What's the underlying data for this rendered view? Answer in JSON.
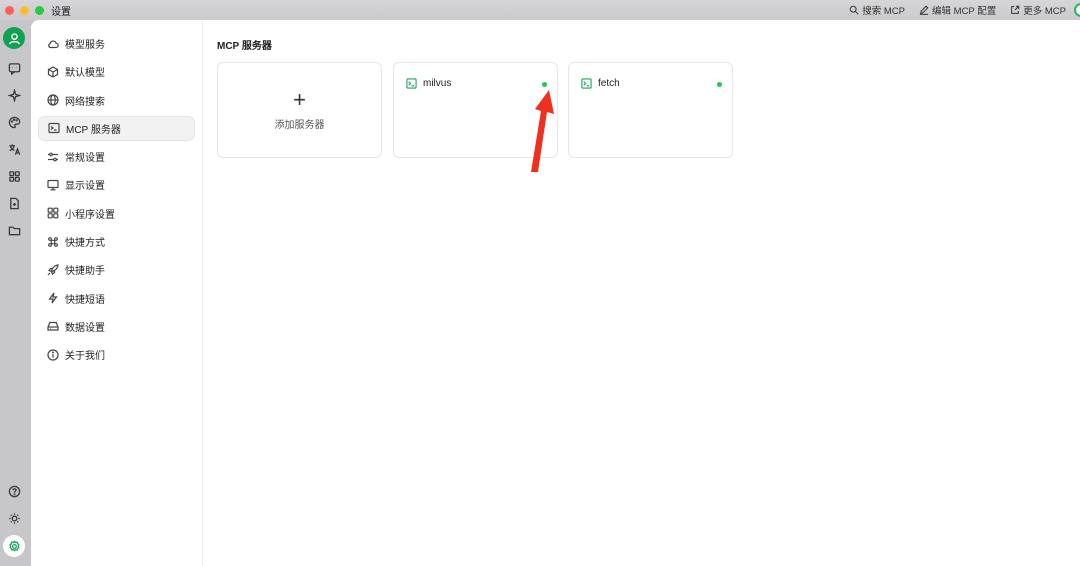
{
  "window": {
    "title": "设置"
  },
  "toolbar": {
    "search_mcp": "搜索 MCP",
    "edit_mcp_config": "编辑 MCP 配置",
    "more_mcp": "更多 MCP"
  },
  "rail": {
    "icons": [
      "user-avatar-icon",
      "chat-icon",
      "sparkle-icon",
      "palette-icon",
      "translate-icon",
      "apps-grid-icon",
      "file-icon",
      "folder-icon",
      "help-icon",
      "brightness-icon",
      "settings-icon"
    ]
  },
  "sidebar": {
    "items": [
      {
        "label": "模型服务",
        "icon": "cloud-icon"
      },
      {
        "label": "默认模型",
        "icon": "cube-icon"
      },
      {
        "label": "网络搜索",
        "icon": "globe-icon"
      },
      {
        "label": "MCP 服务器",
        "icon": "terminal-icon",
        "active": true
      },
      {
        "label": "常规设置",
        "icon": "sliders-icon"
      },
      {
        "label": "显示设置",
        "icon": "monitor-icon"
      },
      {
        "label": "小程序设置",
        "icon": "apps-grid-icon"
      },
      {
        "label": "快捷方式",
        "icon": "command-icon"
      },
      {
        "label": "快捷助手",
        "icon": "rocket-icon"
      },
      {
        "label": "快捷短语",
        "icon": "lightning-icon"
      },
      {
        "label": "数据设置",
        "icon": "hard-drive-icon"
      },
      {
        "label": "关于我们",
        "icon": "info-icon"
      }
    ]
  },
  "main": {
    "title": "MCP 服务器",
    "add_server": {
      "label": "添加服务器",
      "icon": "plus-icon"
    },
    "servers": [
      {
        "name": "milvus",
        "status": "active",
        "status_color": "#22c55e"
      },
      {
        "name": "fetch",
        "status": "active",
        "status_color": "#22c55e"
      }
    ]
  },
  "colors": {
    "accent": "#19a55a",
    "annotation_arrow": "#f0301e"
  }
}
